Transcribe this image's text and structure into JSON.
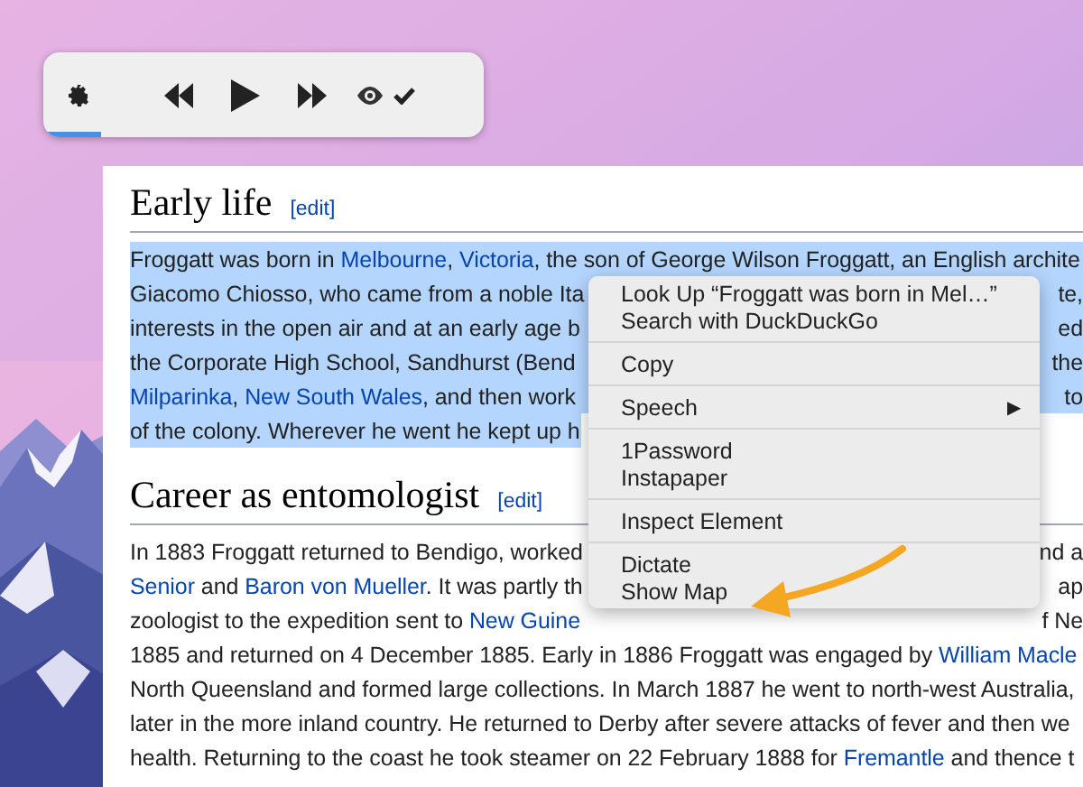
{
  "player": {
    "controls": [
      {
        "kind": "settings"
      },
      {
        "kind": "rewind"
      },
      {
        "kind": "play"
      },
      {
        "kind": "forward"
      },
      {
        "kind": "eye"
      },
      {
        "kind": "check"
      }
    ],
    "progress": {
      "level": 0.13
    }
  },
  "sections": [
    {
      "heading": "Early life",
      "edit": "[edit]",
      "selected": true,
      "lines": [
        {
          "runs": [
            {
              "text": "Froggatt was born in ",
              "kind": "text"
            },
            {
              "text": "Melbourne",
              "kind": "link"
            },
            {
              "text": ", ",
              "kind": "text"
            },
            {
              "text": "Victoria",
              "kind": "link"
            },
            {
              "text": ", the son of George Wilson Froggatt, an English archite",
              "kind": "text"
            }
          ]
        },
        {
          "runs": [
            {
              "text": "Giacomo Chiosso, who came from a noble Ita",
              "kind": "text"
            }
          ],
          "right": "te,"
        },
        {
          "runs": [
            {
              "text": "interests in the open air and at an early age b",
              "kind": "text"
            }
          ],
          "right": "ed"
        },
        {
          "runs": [
            {
              "text": "the Corporate High School, Sandhurst (Bend",
              "kind": "text"
            }
          ],
          "right": "the"
        },
        {
          "runs": [
            {
              "text": "Milparinka",
              "kind": "link"
            },
            {
              "text": ", ",
              "kind": "text"
            },
            {
              "text": "New South Wales",
              "kind": "link"
            },
            {
              "text": ", and then work",
              "kind": "text"
            }
          ],
          "right": "to"
        },
        {
          "runs": [
            {
              "text": "of the colony. Wherever he went he kept up h",
              "kind": "text"
            }
          ]
        }
      ]
    },
    {
      "heading": "Career as entomologist",
      "edit": "[edit]",
      "selected": false,
      "lines": [
        {
          "runs": [
            {
              "text": "In 1883 Froggatt returned to Bendigo, worked",
              "kind": "text"
            }
          ],
          "right": "nd a"
        },
        {
          "runs": [
            {
              "text": "Senior",
              "kind": "link"
            },
            {
              "text": " and ",
              "kind": "text"
            },
            {
              "text": "Baron von Mueller",
              "kind": "link"
            },
            {
              "text": ". It was partly th",
              "kind": "text"
            }
          ],
          "right": "ap"
        },
        {
          "runs": [
            {
              "text": "zoologist to the expedition sent to ",
              "kind": "text"
            },
            {
              "text": "New Guine",
              "kind": "link"
            }
          ],
          "right": "f Ne"
        },
        {
          "runs": [
            {
              "text": "1885 and returned on 4 December 1885. Early in 1886 Froggatt was engaged by ",
              "kind": "text"
            },
            {
              "text": "William Macle",
              "kind": "link"
            }
          ]
        },
        {
          "runs": [
            {
              "text": "North Queensland and formed large collections. In March 1887 he went to north-west Australia,",
              "kind": "text"
            }
          ]
        },
        {
          "runs": [
            {
              "text": "later in the more inland country. He returned to Derby after severe attacks of fever and then we",
              "kind": "text"
            }
          ]
        },
        {
          "runs": [
            {
              "text": "health. Returning to the coast he took steamer on 22 February 1888 for ",
              "kind": "text"
            },
            {
              "text": "Fremantle",
              "kind": "link"
            },
            {
              "text": " and thence t",
              "kind": "text"
            }
          ]
        }
      ]
    }
  ],
  "context_menu": {
    "groups": [
      [
        {
          "label": "Look Up “Froggatt was born in Mel…”"
        },
        {
          "label": "Search with DuckDuckGo"
        }
      ],
      [
        {
          "label": "Copy"
        }
      ],
      [
        {
          "label": "Speech",
          "submenu": "▶"
        }
      ],
      [
        {
          "label": "1Password"
        },
        {
          "label": "Instapaper"
        }
      ],
      [
        {
          "label": "Inspect Element"
        }
      ],
      [
        {
          "label": "Dictate"
        },
        {
          "label": "Show Map"
        }
      ]
    ]
  },
  "annotation": {
    "kind": "arrow"
  }
}
